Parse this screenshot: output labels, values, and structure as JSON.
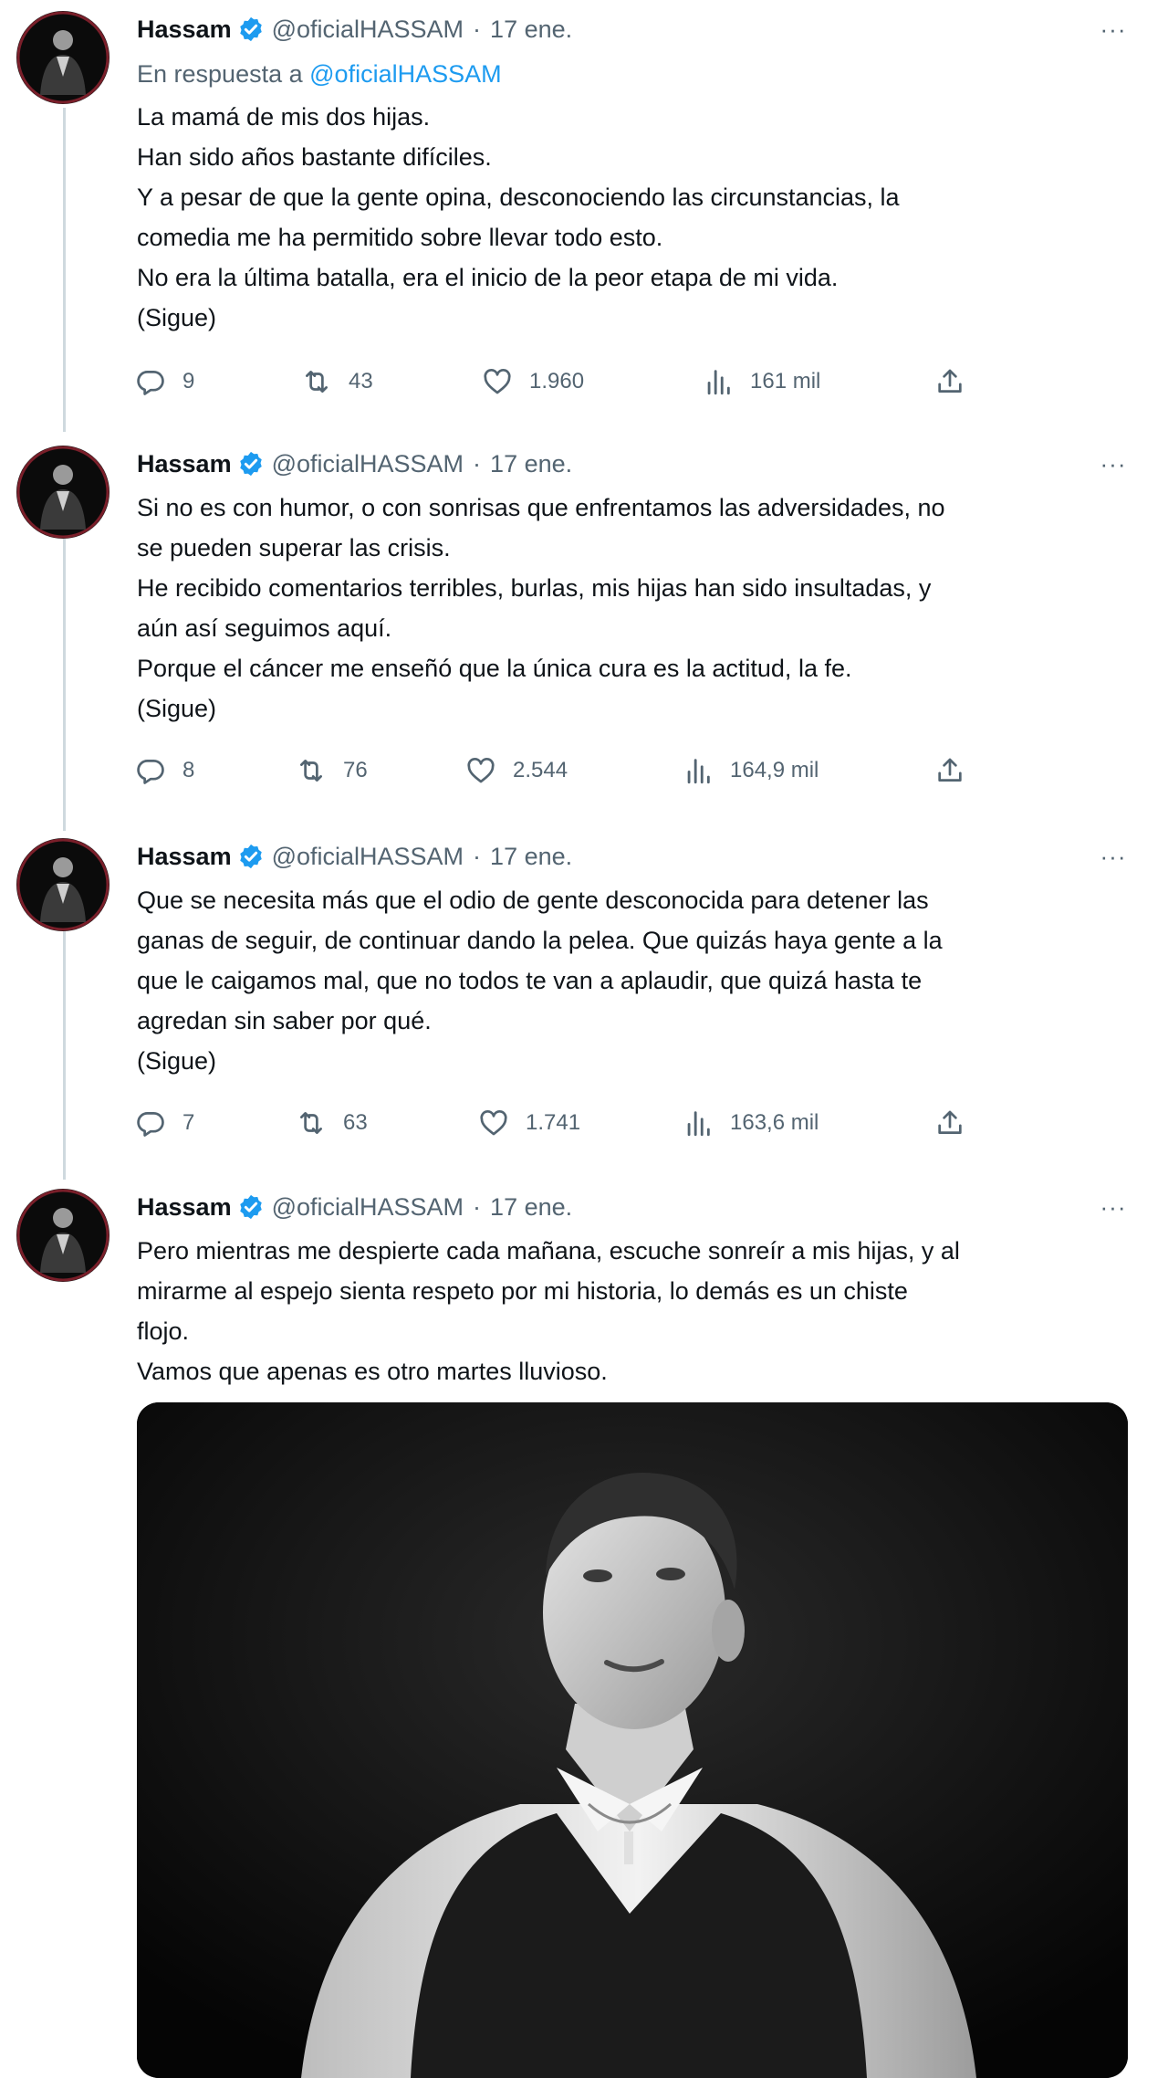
{
  "tweets": [
    {
      "name": "Hassam",
      "handle": "@oficialHASSAM",
      "separator": "·",
      "date": "17 ene.",
      "reply_prefix": "En respuesta a",
      "reply_to": "@oficialHASSAM",
      "lines": [
        "La mamá de mis dos hijas.",
        "Han sido años bastante difíciles.",
        "Y a pesar de que la gente opina, desconociendo las circunstancias, la",
        "comedia me ha permitido sobre llevar todo esto.",
        "No era la última batalla, era el inicio de la peor etapa de mi vida.",
        "(Sigue)"
      ],
      "replies": "9",
      "retweets": "43",
      "likes": "1.960",
      "views": "161 mil"
    },
    {
      "name": "Hassam",
      "handle": "@oficialHASSAM",
      "separator": "·",
      "date": "17 ene.",
      "lines": [
        "Si no es con humor, o con sonrisas que enfrentamos las adversidades, no",
        "se pueden superar las crisis.",
        "He recibido comentarios terribles, burlas, mis hijas han sido insultadas, y",
        "aún así seguimos aquí.",
        "Porque el cáncer me enseñó que la única cura es la actitud, la fe.",
        "(Sigue)"
      ],
      "replies": "8",
      "retweets": "76",
      "likes": "2.544",
      "views": "164,9 mil"
    },
    {
      "name": "Hassam",
      "handle": "@oficialHASSAM",
      "separator": "·",
      "date": "17 ene.",
      "lines": [
        "Que se necesita más que el odio de gente desconocida para detener las",
        "ganas de seguir, de continuar dando la pelea. Que quizás haya gente a la",
        "que le caigamos mal, que no todos te van a aplaudir, que quizá hasta te",
        "agredan sin saber por qué.",
        "(Sigue)"
      ],
      "replies": "7",
      "retweets": "63",
      "likes": "1.741",
      "views": "163,6 mil"
    },
    {
      "name": "Hassam",
      "handle": "@oficialHASSAM",
      "separator": "·",
      "date": "17 ene.",
      "lines": [
        "Pero mientras me despierte cada mañana, escuche sonreír a mis hijas, y al",
        "mirarme al espejo sienta respeto por mi historia, lo demás es un chiste",
        "flojo.",
        "Vamos que apenas es otro martes lluvioso."
      ]
    }
  ],
  "more_label": "···",
  "colors": {
    "accent": "#1d9bf0",
    "secondary_text": "#536471",
    "thread_line": "#cfd9de",
    "avatar_ring": "#7a1f2a"
  },
  "icons": [
    "reply-icon",
    "retweet-icon",
    "like-icon",
    "views-icon",
    "share-icon",
    "verified-icon",
    "more-icon"
  ]
}
